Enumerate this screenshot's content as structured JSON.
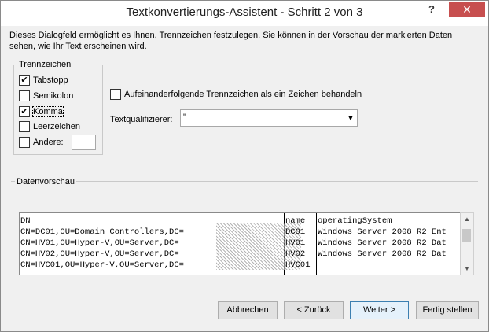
{
  "title": "Textkonvertierungs-Assistent - Schritt 2 von 3",
  "titlebar": {
    "help": "?",
    "close": "✕"
  },
  "description": "Dieses Dialogfeld ermöglicht es Ihnen, Trennzeichen festzulegen. Sie können in der Vorschau der markierten Daten sehen, wie Ihr Text erscheinen wird.",
  "delimiters": {
    "group_label": "Trennzeichen",
    "tab": {
      "label": "Tabstopp",
      "checked": true
    },
    "semicolon": {
      "label": "Semikolon",
      "checked": false
    },
    "comma": {
      "label": "Komma",
      "checked": true
    },
    "space": {
      "label": "Leerzeichen",
      "checked": false
    },
    "other": {
      "label": "Andere:",
      "checked": false,
      "value": ""
    }
  },
  "consecutive": {
    "label": "Aufeinanderfolgende Trennzeichen als ein Zeichen behandeln",
    "checked": false
  },
  "text_qualifier": {
    "label": "Textqualifizierer:",
    "value": "\""
  },
  "preview": {
    "label": "Datenvorschau",
    "columns": [
      {
        "header": "DN",
        "rows": [
          "CN=DC01,OU=Domain Controllers,DC=",
          "CN=HV01,OU=Hyper-V,OU=Server,DC=",
          "CN=HV02,OU=Hyper-V,OU=Server,DC=",
          "CN=HVC01,OU=Hyper-V,OU=Server,DC="
        ]
      },
      {
        "header": "name",
        "rows": [
          "DC01",
          "HV01",
          "HV02",
          "HVC01"
        ]
      },
      {
        "header": "operatingSystem",
        "rows": [
          "Windows Server 2008 R2 Ent",
          "Windows Server 2008 R2 Dat",
          "Windows Server 2008 R2 Dat",
          ""
        ]
      }
    ]
  },
  "buttons": {
    "cancel": "Abbrechen",
    "back": "< Zurück",
    "next": "Weiter >",
    "finish": "Fertig stellen"
  }
}
